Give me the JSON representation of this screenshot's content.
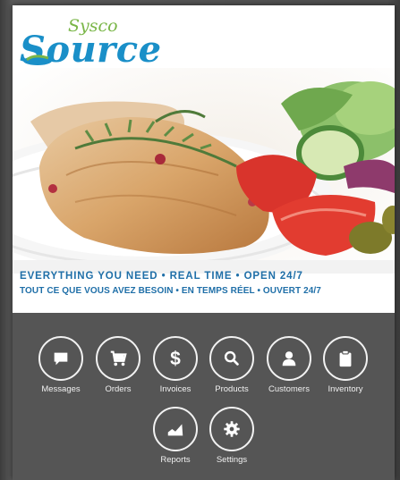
{
  "logo": {
    "sysco": "Sysco",
    "source": "Source"
  },
  "tagline": {
    "english": "EVERYTHING YOU NEED • REAL TIME • OPEN 24/7",
    "french": "TOUT CE QUE VOUS AVEZ BESOIN • EN TEMPS RÉEL • OUVERT 24/7"
  },
  "menu": {
    "messages": {
      "label": "Messages",
      "icon": "chat-bubble-icon"
    },
    "orders": {
      "label": "Orders",
      "icon": "cart-icon"
    },
    "invoices": {
      "label": "Invoices",
      "icon": "dollar-icon",
      "glyph": "$"
    },
    "products": {
      "label": "Products",
      "icon": "search-icon"
    },
    "customers": {
      "label": "Customers",
      "icon": "person-icon"
    },
    "inventory": {
      "label": "Inventory",
      "icon": "clipboard-icon"
    },
    "reports": {
      "label": "Reports",
      "icon": "chart-icon"
    },
    "settings": {
      "label": "Settings",
      "icon": "gear-icon"
    }
  },
  "colors": {
    "brand_blue": "#1a8fc8",
    "brand_green": "#7ab648",
    "tagline_blue": "#1f6fa8",
    "menu_bg": "#555555",
    "icon_outline": "#f2f2f2"
  }
}
